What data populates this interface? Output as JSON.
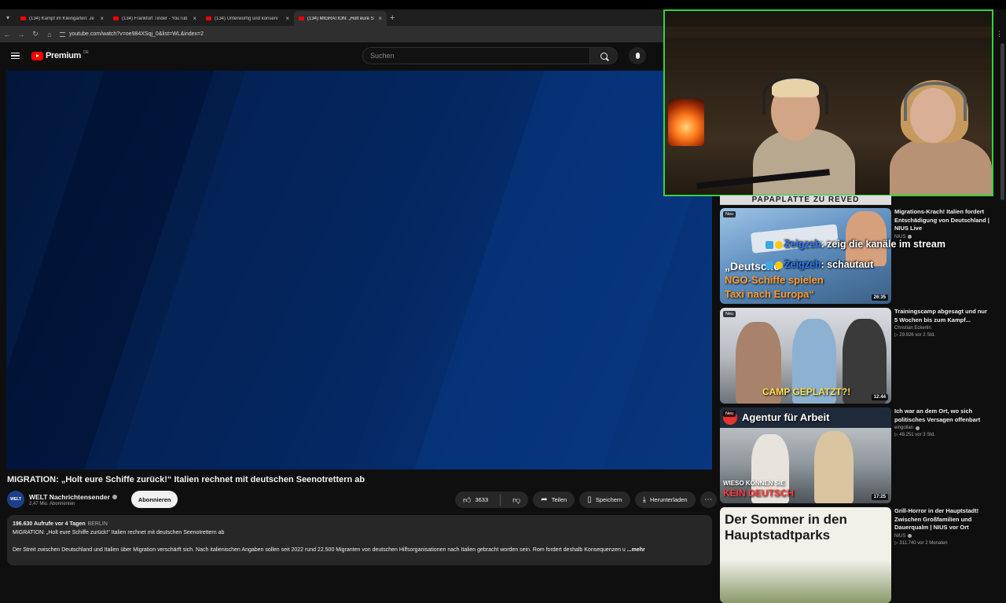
{
  "browser": {
    "tabs": [
      {
        "label": "(134) Kampf im Kleingarten: Je",
        "active": false
      },
      {
        "label": "(134) Frankfurt Tinder - YouTub",
        "active": false
      },
      {
        "label": "(134) Unterwürfig und konserv",
        "active": false
      },
      {
        "label": "(134) MIGRATION: „Holt eure S",
        "active": true
      }
    ],
    "url": "youtube.com/watch?v=oe984XSqj_0&list=WL&index=2"
  },
  "header": {
    "logo_text": "Premium",
    "region": "DE",
    "search_placeholder": "Suchen"
  },
  "video": {
    "title": "MIGRATION: „Holt eure Schiffe zurück!“ Italien rechnet mit deutschen Seenotrettern ab",
    "channel": {
      "avatar_text": "WELT",
      "name": "WELT Nachrichtensender",
      "subscribers": "2,47 Mio. Abonnenten",
      "subscribe_label": "Abonnieren"
    },
    "actions": {
      "likes": "3633",
      "share": "Teilen",
      "save": "Speichern",
      "download": "Herunterladen"
    },
    "description": {
      "views_date": "196.630 Aufrufe  vor 4 Tagen",
      "location": "BERLIN",
      "headline": "MIGRATION: „Holt eure Schiffe zurück!“ Italien rechnet mit deutschen Seenotrettern ab",
      "text": "Der Streit zwischen Deutschland und Italien über Migration verschärft sich. Nach italienischen Angaben sollen seit 2022 rund 22.500 Migranten von deutschen Hilfsorganisationen nach Italien gebracht worden sein. Rom fordert deshalb Konsequenzen u",
      "more": "...mehr"
    }
  },
  "overlay": {
    "banner_text": "PAPAPLATTE ZU REVED",
    "chat": [
      {
        "user": "Zeigzeh",
        "message": ": zeig die kanäle im stream"
      },
      {
        "user": "Zeigzeh",
        "message": ": schautaut"
      }
    ]
  },
  "recommendations": [
    {
      "badge": "Neu",
      "duration": "26:35",
      "thumb_lines": [
        "„Deutsche",
        "NGO-Schiffe spielen",
        "Taxi nach Europa“"
      ],
      "title": "Migrations-Krach! Italien fordert Entschädigung von Deutschland | NIUS Live",
      "channel": "NIUS",
      "stats": ""
    },
    {
      "badge": "Neu",
      "duration": "12:44",
      "thumb_lines": [
        "CAMP GEPLATZT?!"
      ],
      "title": "Trainingscamp abgesagt und nur 5 Wochen bis zum Kampf...",
      "channel": "Christian Eckerlin",
      "stats": "▷ 29.926  vor 2 Std."
    },
    {
      "badge": "Neu",
      "duration": "17:25",
      "thumb_lines": [
        "Agentur für Arbeit",
        "WIESO KÖNNEN SIE",
        "KEIN DEUTSCH"
      ],
      "title": "Ich war an dem Ort, wo sich politisches Versagen offenbart",
      "channel": "eingollan",
      "stats": "▷ 48.251  vor 3 Std."
    },
    {
      "badge": "",
      "duration": "",
      "thumb_lines": [
        "Der Sommer in den",
        "Hauptstadtparks"
      ],
      "title": "Grill-Horror in der Hauptstadt! Zwischen Großfamilien und Dauerqualm | NIUS vor Ort",
      "channel": "NIUS",
      "stats": "▷ 311.740  vor 2 Monaten"
    }
  ]
}
